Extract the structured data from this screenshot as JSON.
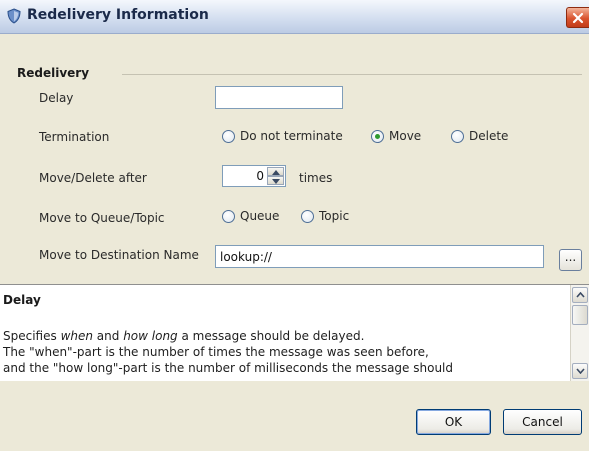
{
  "window": {
    "title": "Redelivery Information",
    "icon": "shield-icon",
    "close_icon": "close-icon"
  },
  "form": {
    "section_title": "Redelivery",
    "delay": {
      "label": "Delay",
      "value": ""
    },
    "termination": {
      "label": "Termination",
      "options": [
        "Do not terminate",
        "Move",
        "Delete"
      ],
      "selected": "Move"
    },
    "move_delete_after": {
      "label": "Move/Delete after",
      "value": "0",
      "suffix": "times"
    },
    "move_to": {
      "label": "Move to Queue/Topic",
      "options": [
        "Queue",
        "Topic"
      ],
      "selected": ""
    },
    "destination": {
      "label": "Move to Destination Name",
      "value": "lookup://",
      "browse_label": "..."
    }
  },
  "help": {
    "title": "Delay",
    "line1_a": "Specifies ",
    "line1_em1": "when",
    "line1_b": " and ",
    "line1_em2": "how long",
    "line1_c": " a message should be delayed.",
    "line2": "The \"when\"-part is the number of times the message was seen before,",
    "line3": "and the \"how long\"-part is the number of milliseconds the message should"
  },
  "buttons": {
    "ok": "OK",
    "cancel": "Cancel"
  },
  "colors": {
    "accent": "#2f9a2f",
    "close": "#d9542f",
    "border": "#7f9db9"
  }
}
